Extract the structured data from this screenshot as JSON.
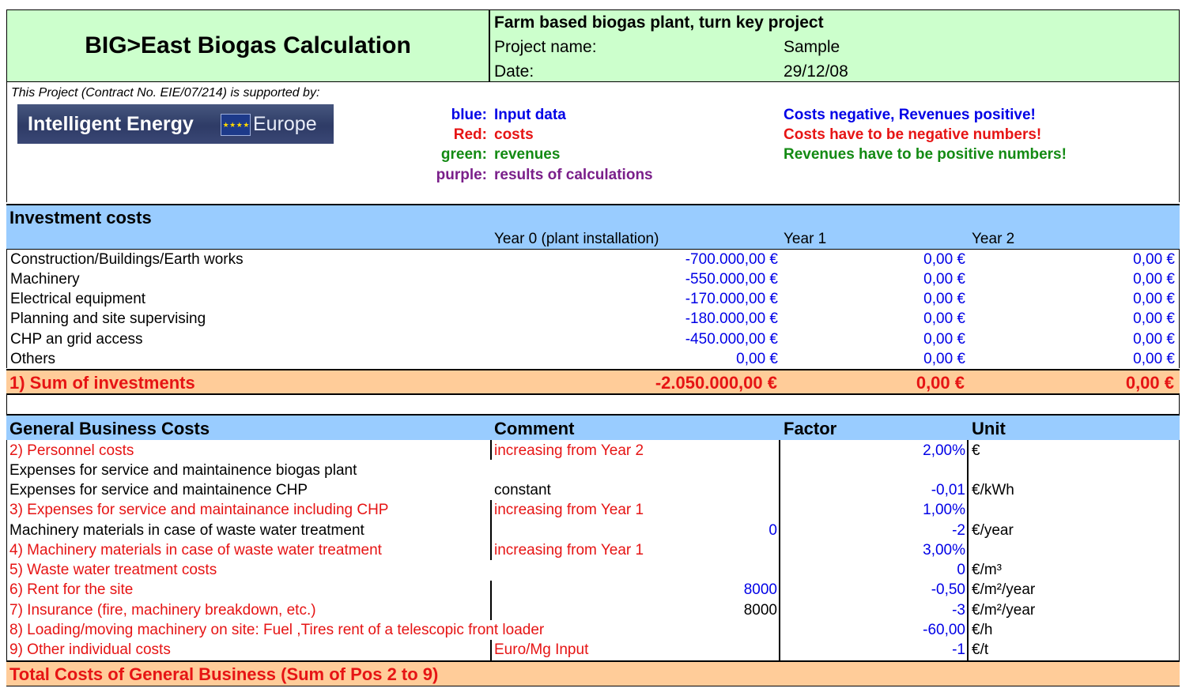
{
  "header": {
    "main_title": "BIG>East Biogas Calculation",
    "subtitle": "Farm based biogas plant, turn key project",
    "project_name_label": "Project name:",
    "project_name_value": "Sample",
    "date_label": "Date:",
    "date_value": "29/12/08"
  },
  "support": {
    "text": "This Project (Contract No. EIE/07/214) is supported by:",
    "logo_text_1": "Intelligent Energy",
    "logo_text_2": "Europe"
  },
  "legend": [
    {
      "key": "blue:",
      "value": "Input data",
      "color": "#0000e6"
    },
    {
      "key": "Red:",
      "value": "costs",
      "color": "#e61414"
    },
    {
      "key": "green:",
      "value": "revenues",
      "color": "#138a13"
    },
    {
      "key": "purple:",
      "value": "results of calculations",
      "color": "#7a1f8a"
    }
  ],
  "notes": [
    {
      "text": "Costs negative, Revenues positive!",
      "color": "#0000e6"
    },
    {
      "text": "Costs have to be negative numbers!",
      "color": "#e61414"
    },
    {
      "text": "Revenues have to be positive numbers!",
      "color": "#138a13"
    }
  ],
  "investment": {
    "title": "Investment costs",
    "col_year0": "Year 0 (plant installation)",
    "col_year1": "Year 1",
    "col_year2": "Year 2",
    "rows": [
      {
        "label": "Construction/Buildings/Earth works",
        "y0": "-700.000,00 €",
        "y1": "0,00 €",
        "y2": "0,00 €"
      },
      {
        "label": "Machinery",
        "y0": "-550.000,00 €",
        "y1": "0,00 €",
        "y2": "0,00 €"
      },
      {
        "label": "Electrical equipment",
        "y0": "-170.000,00 €",
        "y1": "0,00 €",
        "y2": "0,00 €"
      },
      {
        "label": "Planning and site supervising",
        "y0": "-180.000,00 €",
        "y1": "0,00 €",
        "y2": "0,00 €"
      },
      {
        "label": "CHP an grid access",
        "y0": "-450.000,00 €",
        "y1": "0,00 €",
        "y2": "0,00 €"
      },
      {
        "label": "Others",
        "y0": "0,00 €",
        "y1": "0,00 €",
        "y2": "0,00 €"
      }
    ],
    "sum": {
      "label": "1) Sum of investments",
      "y0": "-2.050.000,00 €",
      "y1": "0,00 €",
      "y2": "0,00 €"
    }
  },
  "gbc": {
    "title": "General Business Costs",
    "col_comment": "Comment",
    "col_factor": "Factor",
    "col_unit": "Unit",
    "rows": [
      {
        "label": "2) Personnel costs",
        "label_color": "#e61414",
        "comment": "increasing from Year 2",
        "comment_color": "#e61414",
        "input": "",
        "input_color": "#0000e6",
        "factor": "2,00%",
        "unit": "€"
      },
      {
        "label": "Expenses for service and maintainence biogas plant",
        "label_color": "#000000",
        "comment": "",
        "comment_color": "#000000",
        "input": "",
        "input_color": "#0000e6",
        "factor": "",
        "unit": ""
      },
      {
        "label": "Expenses for service and maintainence CHP",
        "label_color": "#000000",
        "comment": "constant",
        "comment_color": "#000000",
        "input": "",
        "input_color": "#0000e6",
        "factor": "-0,01",
        "unit": "€/kWh"
      },
      {
        "label": "3) Expenses for service and maintainance including CHP",
        "label_color": "#e61414",
        "comment": "increasing from Year 1",
        "comment_color": "#e61414",
        "input": "",
        "input_color": "#0000e6",
        "factor": "1,00%",
        "unit": ""
      },
      {
        "label": "Machinery materials in case of waste water treatment",
        "label_color": "#000000",
        "comment": "",
        "comment_color": "#000000",
        "input": "0",
        "input_color": "#0000e6",
        "factor": "-2",
        "unit": "€/year"
      },
      {
        "label": "4) Machinery materials in case of waste water treatment",
        "label_color": "#e61414",
        "comment": "increasing from Year 1",
        "comment_color": "#e61414",
        "input": "",
        "input_color": "#0000e6",
        "factor": "3,00%",
        "unit": ""
      },
      {
        "label": "5) Waste water treatment costs",
        "label_color": "#e61414",
        "comment": "",
        "comment_color": "#000000",
        "input": "",
        "input_color": "#0000e6",
        "factor": "0",
        "unit": "€/m³"
      },
      {
        "label": "6)  Rent for the site",
        "label_color": "#e61414",
        "comment": "",
        "comment_color": "#000000",
        "input": "8000",
        "input_color": "#0000e6",
        "factor": "-0,50",
        "unit": "€/m²/year"
      },
      {
        "label": "7)  Insurance (fire, machinery breakdown,  etc.)",
        "label_color": "#e61414",
        "comment": "",
        "comment_color": "#000000",
        "input": "8000",
        "input_color": "#000000",
        "factor": "-3",
        "unit": "€/m²/year"
      },
      {
        "label": "8) Loading/moving machinery on site: Fuel ,Tires rent of a telescopic front loader",
        "label_color": "#e61414",
        "comment": "",
        "comment_color": "#000000",
        "input": "",
        "input_color": "#0000e6",
        "factor": "-60,00",
        "unit": "€/h"
      },
      {
        "label": "9) Other individual costs",
        "label_color": "#e61414",
        "comment": "Euro/Mg Input",
        "comment_color": "#e61414",
        "input": "",
        "input_color": "#0000e6",
        "factor": "-1",
        "unit": "€/t"
      }
    ],
    "total_label": "Total Costs of General Business (Sum of Pos 2 to 9)"
  }
}
